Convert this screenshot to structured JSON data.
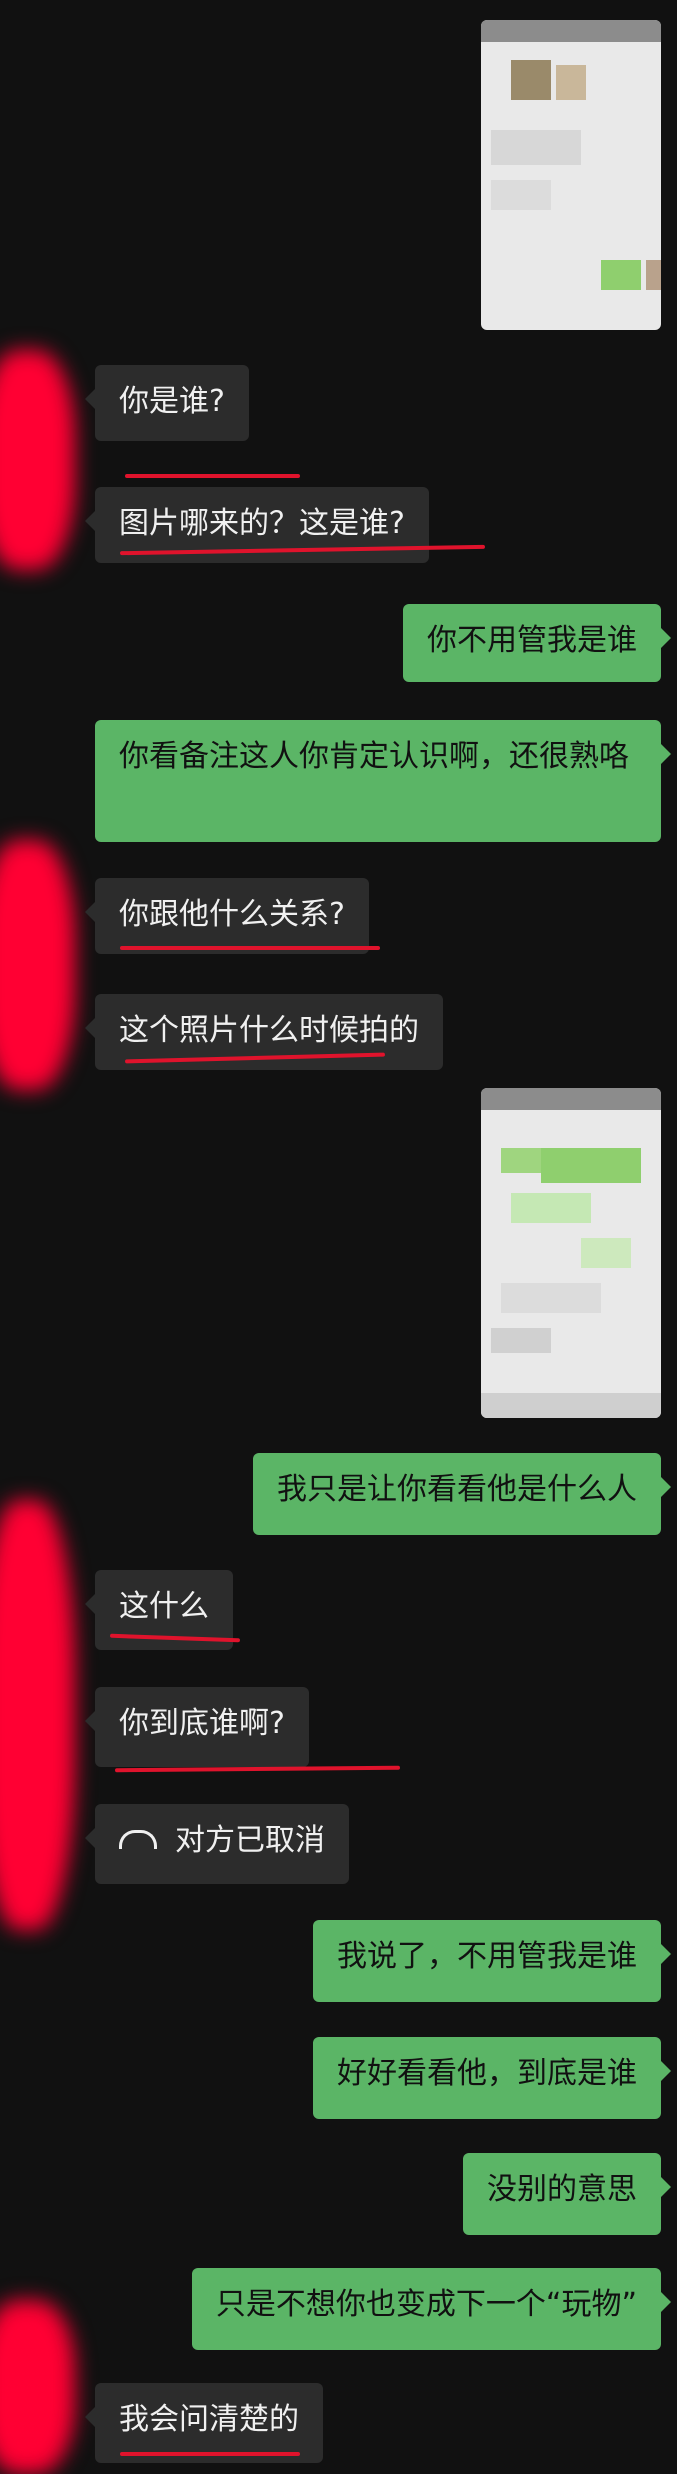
{
  "messages": {
    "m1": "你是谁?",
    "m2": "图片哪来的？这是谁?",
    "m3": "你不用管我是谁",
    "m4": "你看备注这人你肯定认识啊，还很熟咯",
    "m5": "你跟他什么关系?",
    "m6": "这个照片什么时候拍的",
    "m7": "我只是让你看看他是什么人",
    "m8": "这什么",
    "m9": "你到底谁啊?",
    "m10": "对方已取消",
    "m11": "我说了，不用管我是谁",
    "m12": "好好看看他，到底是谁",
    "m13": "没别的意思",
    "m14": "只是不想你也变成下一个“玩物”",
    "m15": "我会问清楚的"
  },
  "icons": {
    "call": "phone-hangup-icon"
  },
  "colors": {
    "background": "#111111",
    "incoming_bubble": "#2c2c2c",
    "outgoing_bubble": "#5bb566",
    "annotation_red": "#e0132c"
  }
}
